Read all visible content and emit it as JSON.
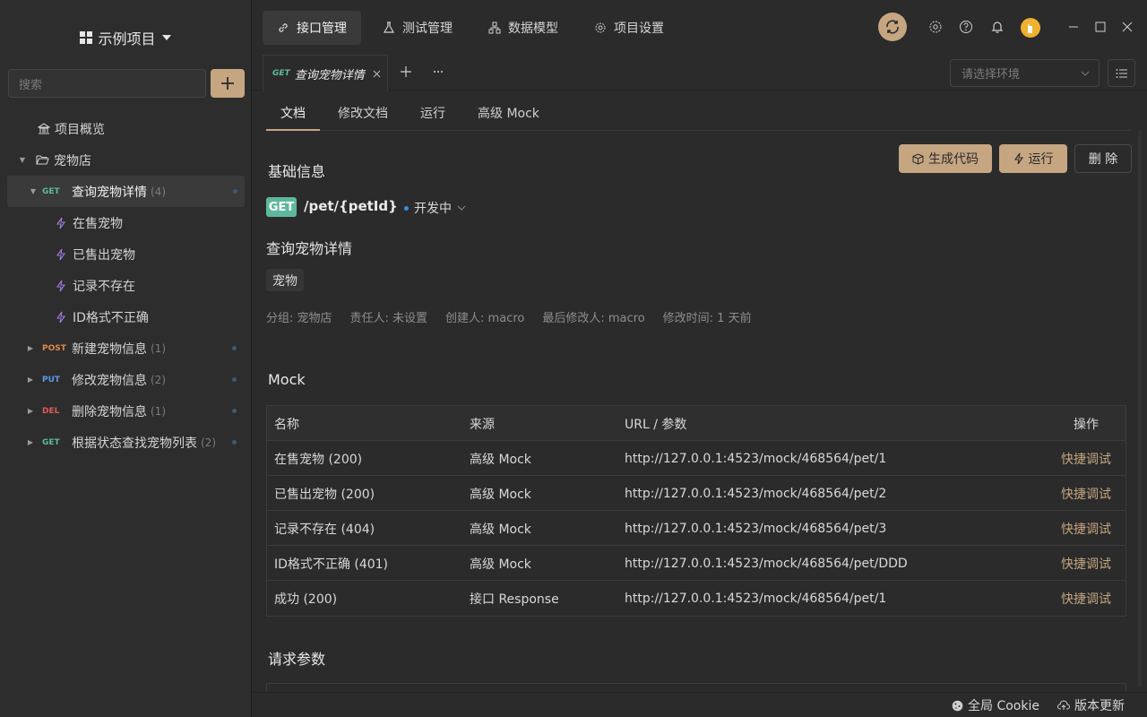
{
  "colors": {
    "accent": "#c5a681",
    "get": "#5fb89d",
    "post": "#e0884a",
    "put": "#5b9be6",
    "del": "#e05a5a"
  },
  "sidebar": {
    "project_title": "示例项目",
    "search_placeholder": "搜索",
    "overview": "项目概览",
    "folder": "宠物店",
    "selected": {
      "method": "GET",
      "label": "查询宠物详情",
      "count": "(4)"
    },
    "children": [
      "在售宠物",
      "已售出宠物",
      "记录不存在",
      "ID格式不正确"
    ],
    "others": [
      {
        "method": "POST",
        "label": "新建宠物信息",
        "count": "(1)"
      },
      {
        "method": "PUT",
        "label": "修改宠物信息",
        "count": "(2)"
      },
      {
        "method": "DEL",
        "label": "删除宠物信息",
        "count": "(1)"
      },
      {
        "method": "GET",
        "label": "根据状态查找宠物列表",
        "count": "(2)"
      }
    ]
  },
  "topnav": {
    "tabs": [
      "接口管理",
      "测试管理",
      "数据模型",
      "项目设置"
    ]
  },
  "tabstrip": {
    "method": "GET",
    "title": "查询宠物详情",
    "env_placeholder": "请选择环境"
  },
  "subtabs": [
    "文档",
    "修改文档",
    "运行",
    "高级 Mock"
  ],
  "actions": {
    "gen_code": "生成代码",
    "run": "运行",
    "delete": "删 除"
  },
  "basic": {
    "section": "基础信息",
    "method": "GET",
    "path": "/pet/{petId}",
    "status": "开发中",
    "name": "查询宠物详情",
    "tag": "宠物",
    "meta": [
      "分组: 宠物店",
      "责任人: 未设置",
      "创建人:  macro",
      "最后修改人:  macro",
      "修改时间: 1 天前"
    ]
  },
  "mock": {
    "section": "Mock",
    "headers": [
      "名称",
      "来源",
      "URL / 参数",
      "操作"
    ],
    "rows": [
      [
        "在售宠物 (200)",
        "高级 Mock",
        "http://127.0.0.1:4523/mock/468564/pet/1",
        "快捷调试"
      ],
      [
        "已售出宠物 (200)",
        "高级 Mock",
        "http://127.0.0.1:4523/mock/468564/pet/2",
        "快捷调试"
      ],
      [
        "记录不存在 (404)",
        "高级 Mock",
        "http://127.0.0.1:4523/mock/468564/pet/3",
        "快捷调试"
      ],
      [
        "ID格式不正确 (401)",
        "高级 Mock",
        "http://127.0.0.1:4523/mock/468564/pet/DDD",
        "快捷调试"
      ],
      [
        "成功 (200)",
        "接口 Response",
        "http://127.0.0.1:4523/mock/468564/pet/1",
        "快捷调试"
      ]
    ]
  },
  "request_section": "请求参数",
  "bottom": {
    "cookie": "全局 Cookie",
    "update": "版本更新"
  }
}
